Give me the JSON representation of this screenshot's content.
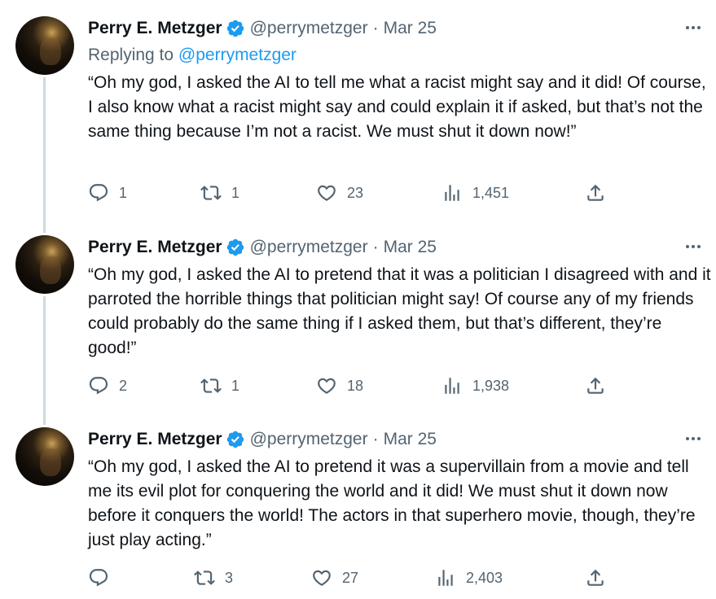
{
  "tweets": [
    {
      "author_name": "Perry E. Metzger",
      "handle": "@perrymetzger",
      "separator": "·",
      "date": "Mar 25",
      "replying_label": "Replying to ",
      "replying_handle": "@perrymetzger",
      "text": "“Oh my god, I asked the AI to tell me what a racist might say and it did! Of course, I also know what a racist might say and could explain it if asked, but that’s not the same thing because I’m not a racist. We must shut it down now!”",
      "replies": "1",
      "retweets": "1",
      "likes": "23",
      "views": "1,451"
    },
    {
      "author_name": "Perry E. Metzger",
      "handle": "@perrymetzger",
      "separator": "·",
      "date": "Mar 25",
      "text": "“Oh my god, I asked the AI to pretend that it was a politician I disagreed with and it parroted the horrible things that politician might say! Of course any of my friends could probably do the same thing if I asked them, but that’s different, they’re good!”",
      "replies": "2",
      "retweets": "1",
      "likes": "18",
      "views": "1,938"
    },
    {
      "author_name": "Perry E. Metzger",
      "handle": "@perrymetzger",
      "separator": "·",
      "date": "Mar 25",
      "text": "“Oh my god, I asked the AI to pretend it was a supervillain from a movie and tell me its evil plot for conquering the world and it did! We must shut it down now before it conquers the world! The actors in that superhero movie, though, they’re just play acting.”",
      "replies": "",
      "retweets": "3",
      "likes": "27",
      "views": "2,403"
    }
  ],
  "icons": {
    "verified": "verified-badge-icon",
    "more": "more-horizontal-icon",
    "reply": "reply-icon",
    "retweet": "retweet-icon",
    "like": "heart-icon",
    "views": "views-icon",
    "share": "share-icon"
  },
  "colors": {
    "accent": "#1d9bf0",
    "muted": "#536471",
    "text": "#0f1419",
    "thread_line": "#cfd9de"
  }
}
